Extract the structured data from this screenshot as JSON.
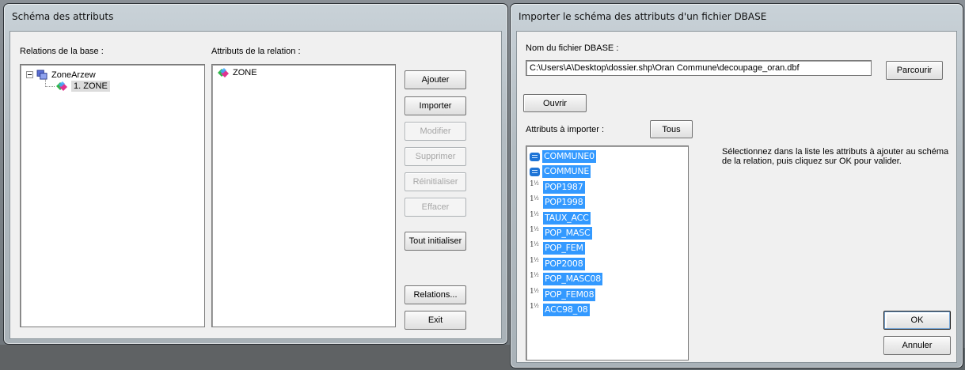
{
  "left_window": {
    "title": "Schéma des attributs",
    "relations_label": "Relations de la base :",
    "attributes_label": "Attributs de la relation :",
    "tree": {
      "root": "ZoneArzew",
      "child": "1. ZONE"
    },
    "attributes": [
      "ZONE"
    ],
    "buttons": {
      "add": "Ajouter",
      "import": "Importer",
      "modify": "Modifier",
      "delete": "Supprimer",
      "reset": "Réinitialiser",
      "clear": "Effacer",
      "reset_all": "Tout initialiser",
      "relations": "Relations...",
      "exit": "Exit"
    }
  },
  "right_window": {
    "title": "Importer le schéma des attributs d'un fichier DBASE",
    "file_label": "Nom du fichier DBASE :",
    "file_path": "C:\\Users\\A\\Desktop\\dossier.shp\\Oran Commune\\decoupage_oran.dbf",
    "browse": "Parcourir",
    "open": "Ouvrir",
    "attributes_label": "Attributs à importer :",
    "all": "Tous",
    "instructions": "Sélectionnez dans la liste les attributs à ajouter au schéma de la relation, puis cliquez sur OK pour valider.",
    "ok": "OK",
    "cancel": "Annuler",
    "attributes": [
      {
        "name": "COMMUNE0",
        "type": "text"
      },
      {
        "name": "COMMUNE",
        "type": "text"
      },
      {
        "name": "POP1987",
        "type": "number"
      },
      {
        "name": "POP1998",
        "type": "number"
      },
      {
        "name": "TAUX_ACC",
        "type": "number"
      },
      {
        "name": "POP_MASC",
        "type": "number"
      },
      {
        "name": "POP_FEM",
        "type": "number"
      },
      {
        "name": "POP2008",
        "type": "number"
      },
      {
        "name": "POP_MASC08",
        "type": "number"
      },
      {
        "name": "POP_FEM08",
        "type": "number"
      },
      {
        "name": "ACC98_08",
        "type": "number"
      }
    ],
    "number_icon_glyph": "1½"
  },
  "colors": {
    "selection": "#3399ff",
    "text_icon": "#1e74d6"
  }
}
